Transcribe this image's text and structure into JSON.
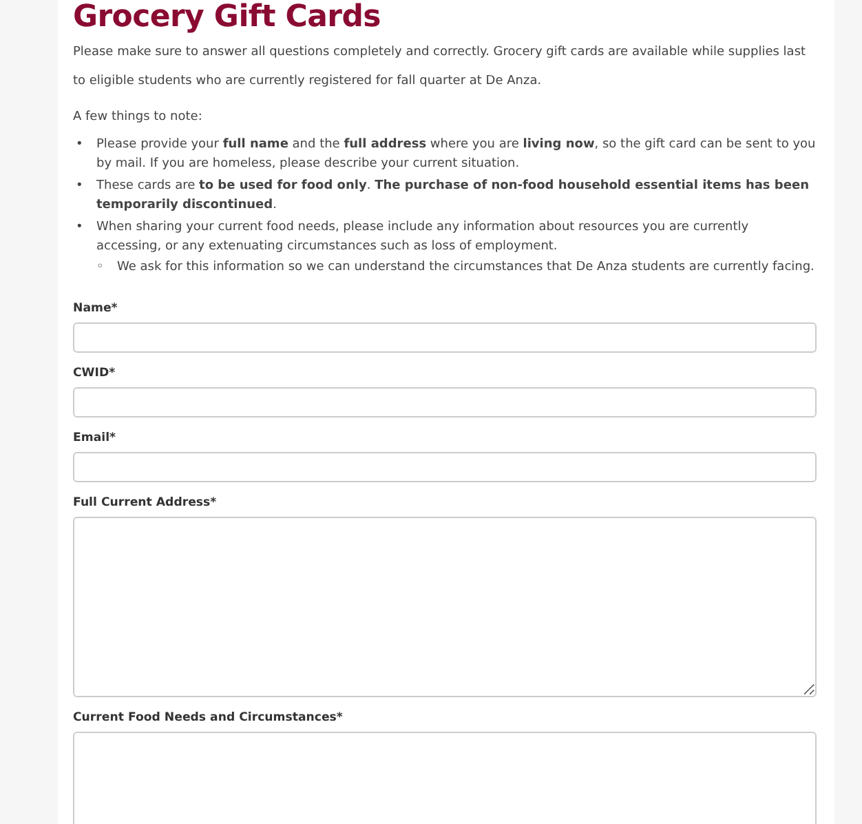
{
  "title": "Grocery Gift Cards",
  "intro": "Please make sure to answer all questions completely and correctly. Grocery gift cards are available while supplies last to eligible students who are currently registered for fall quarter at De Anza.",
  "note_heading": "A few things to note:",
  "notes": [
    {
      "marker": "•",
      "text": "Please provide your **full name** and the **full address** where you are **living now**, so the gift card can be sent to you by mail. If you are homeless, please describe your current situation."
    },
    {
      "marker": "•",
      "text": "These cards are **to be used for food only**. **The purchase of non-food household essential items has been temporarily discontinued**."
    },
    {
      "marker": "•",
      "text": "When sharing your current food needs, please include any information about resources you are currently accessing, or any extenuating circumstances such as loss of employment.",
      "children": [
        {
          "marker": "◦",
          "text": "We ask for this information so we can understand the circumstances that De Anza students are currently facing."
        }
      ]
    }
  ],
  "fields": [
    {
      "label": "Name*",
      "kind": "input"
    },
    {
      "label": "CWID*",
      "kind": "input"
    },
    {
      "label": "Email*",
      "kind": "input"
    },
    {
      "label": "Full Current Address*",
      "kind": "textarea"
    },
    {
      "label": "Current Food Needs and Circumstances*",
      "kind": "textarea"
    }
  ]
}
